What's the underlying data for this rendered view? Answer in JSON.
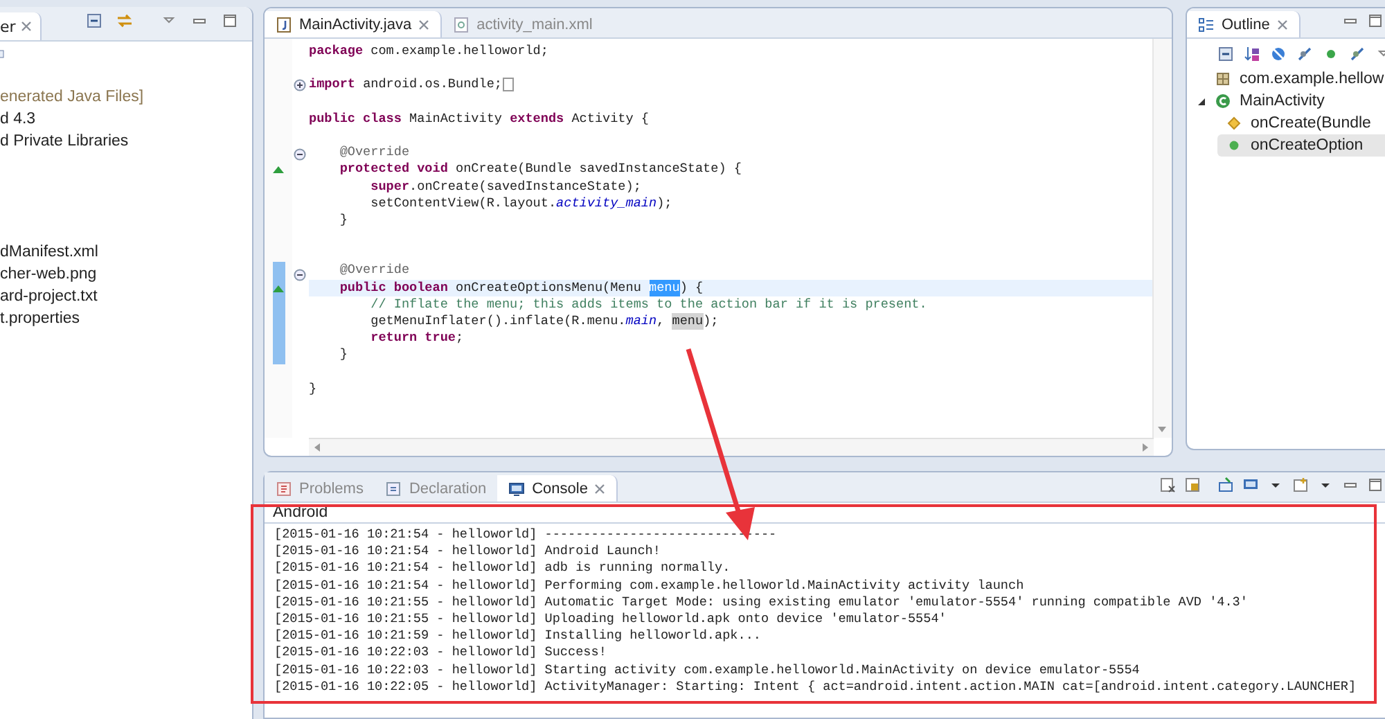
{
  "package_explorer": {
    "tab": {
      "label": "er",
      "selected": true
    },
    "tree_top": [
      {
        "label": "enerated Java Files]",
        "generated": true
      },
      {
        "label": "d 4.3",
        "generated": false
      },
      {
        "label": "d Private Libraries",
        "generated": false
      }
    ],
    "tree_bottom": [
      {
        "label": "dManifest.xml"
      },
      {
        "label": "cher-web.png"
      },
      {
        "label": "ard-project.txt"
      },
      {
        "label": "t.properties"
      }
    ]
  },
  "editor": {
    "tabs": [
      {
        "label": "MainActivity.java",
        "kind": "java",
        "selected": true
      },
      {
        "label": "activity_main.xml",
        "kind": "xml",
        "selected": false
      }
    ],
    "lines": [
      {
        "kind": "code",
        "tokens": [
          {
            "kind": "keyword",
            "text": "package"
          },
          {
            "kind": "plain",
            "text": " com.example.helloworld;"
          }
        ]
      },
      {
        "kind": "blank"
      },
      {
        "kind": "code",
        "collapsed": true,
        "tokens": [
          {
            "kind": "keyword",
            "text": "import"
          },
          {
            "kind": "plain",
            "text": " android.os.Bundle;"
          }
        ]
      },
      {
        "kind": "blank"
      },
      {
        "kind": "code",
        "tokens": [
          {
            "kind": "keyword",
            "text": "public class"
          },
          {
            "kind": "plain",
            "text": " MainActivity "
          },
          {
            "kind": "keyword",
            "text": "extends"
          },
          {
            "kind": "plain",
            "text": " Activity {"
          }
        ]
      },
      {
        "kind": "blank"
      },
      {
        "kind": "code",
        "collapsed": false,
        "tokens": [
          {
            "kind": "annotation",
            "text": "    @Override"
          }
        ]
      },
      {
        "kind": "code",
        "override": true,
        "tokens": [
          {
            "kind": "keyword",
            "text": "    protected void"
          },
          {
            "kind": "plain",
            "text": " onCreate(Bundle savedInstanceState) {"
          }
        ]
      },
      {
        "kind": "code",
        "tokens": [
          {
            "kind": "keyword",
            "text": "        super"
          },
          {
            "kind": "plain",
            "text": ".onCreate(savedInstanceState);"
          }
        ]
      },
      {
        "kind": "code",
        "tokens": [
          {
            "kind": "plain",
            "text": "        setContentView(R.layout."
          },
          {
            "kind": "field",
            "text": "activity_main"
          },
          {
            "kind": "plain",
            "text": ");"
          }
        ]
      },
      {
        "kind": "code",
        "tokens": [
          {
            "kind": "plain",
            "text": "    }"
          }
        ]
      },
      {
        "kind": "blank"
      },
      {
        "kind": "blank"
      },
      {
        "kind": "code",
        "collapsed": false,
        "changed": true,
        "tokens": [
          {
            "kind": "annotation",
            "text": "    @Override"
          }
        ]
      },
      {
        "kind": "code",
        "override": true,
        "current": true,
        "changed": true,
        "tokens": [
          {
            "kind": "keyword",
            "text": "    public boolean"
          },
          {
            "kind": "plain",
            "text": " onCreateOptionsMenu(Menu "
          },
          {
            "kind": "selection",
            "text": "menu"
          },
          {
            "kind": "plain",
            "text": ") {"
          }
        ]
      },
      {
        "kind": "code",
        "changed": true,
        "tokens": [
          {
            "kind": "comment",
            "text": "        // Inflate the menu; this adds items to the action bar if it is present."
          }
        ]
      },
      {
        "kind": "code",
        "changed": true,
        "tokens": [
          {
            "kind": "plain",
            "text": "        getMenuInflater().inflate(R.menu."
          },
          {
            "kind": "field",
            "text": "main"
          },
          {
            "kind": "plain",
            "text": ", "
          },
          {
            "kind": "occurrence",
            "text": "menu"
          },
          {
            "kind": "plain",
            "text": ");"
          }
        ]
      },
      {
        "kind": "code",
        "changed": true,
        "tokens": [
          {
            "kind": "keyword",
            "text": "        return true"
          },
          {
            "kind": "plain",
            "text": ";"
          }
        ]
      },
      {
        "kind": "code",
        "changed": true,
        "tokens": [
          {
            "kind": "plain",
            "text": "    }"
          }
        ]
      },
      {
        "kind": "blank"
      },
      {
        "kind": "code",
        "tokens": [
          {
            "kind": "plain",
            "text": "}"
          }
        ]
      }
    ]
  },
  "outline": {
    "tab": {
      "label": "Outline",
      "selected": true
    },
    "tree": [
      {
        "label": "com.example.hellow",
        "kind": "package"
      },
      {
        "label": "MainActivity",
        "kind": "class",
        "expanded": true,
        "children": [
          {
            "label": "onCreate(Bundle",
            "kind": "protected-method",
            "selected": false
          },
          {
            "label": "onCreateOption",
            "kind": "public-method",
            "selected": true
          }
        ]
      }
    ]
  },
  "console": {
    "tabs": [
      {
        "label": "Problems",
        "kind": "problems",
        "selected": false
      },
      {
        "label": "Declaration",
        "kind": "declaration",
        "selected": false
      },
      {
        "label": "Console",
        "kind": "console",
        "selected": true
      }
    ],
    "header": "Android",
    "lines": [
      "[2015-01-16 10:21:54 - helloworld] ------------------------------",
      "[2015-01-16 10:21:54 - helloworld] Android Launch!",
      "[2015-01-16 10:21:54 - helloworld] adb is running normally.",
      "[2015-01-16 10:21:54 - helloworld] Performing com.example.helloworld.MainActivity activity launch",
      "[2015-01-16 10:21:55 - helloworld] Automatic Target Mode: using existing emulator 'emulator-5554' running compatible AVD '4.3'",
      "[2015-01-16 10:21:55 - helloworld] Uploading helloworld.apk onto device 'emulator-5554'",
      "[2015-01-16 10:21:59 - helloworld] Installing helloworld.apk...",
      "[2015-01-16 10:22:03 - helloworld] Success!",
      "[2015-01-16 10:22:03 - helloworld] Starting activity com.example.helloworld.MainActivity on device emulator-5554",
      "[2015-01-16 10:22:05 - helloworld] ActivityManager: Starting: Intent { act=android.intent.action.MAIN cat=[android.intent.category.LAUNCHER]"
    ]
  }
}
